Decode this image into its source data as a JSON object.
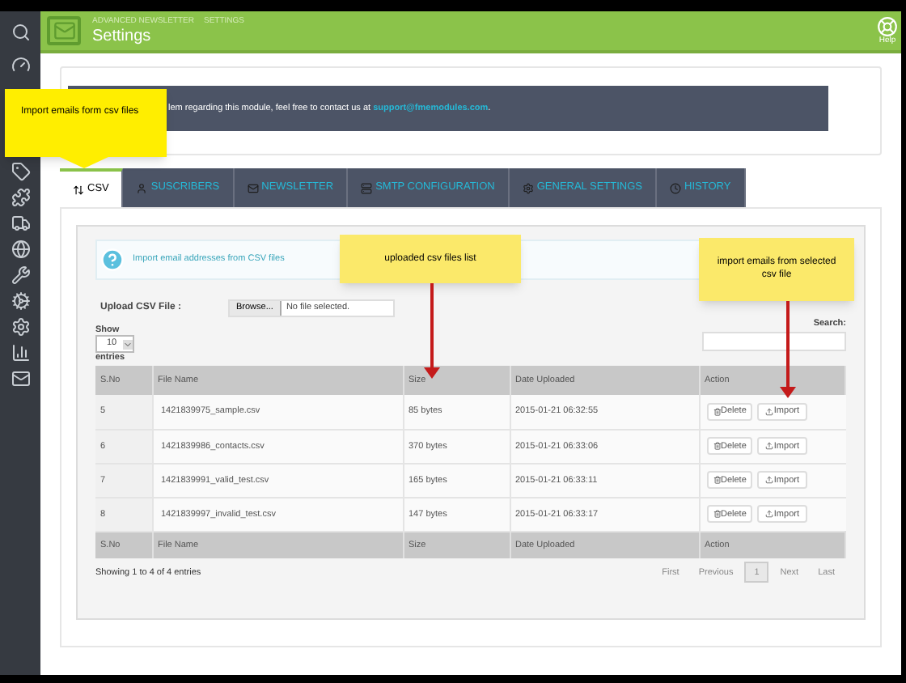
{
  "header": {
    "breadcrumb": [
      "ADVANCED NEWSLETTER",
      "SETTINGS"
    ],
    "title": "Settings",
    "help": "Help"
  },
  "banner": {
    "text": "lem regarding this module, feel free to contact us at",
    "link": "support@fmemodules.com",
    "end": "."
  },
  "tabs": [
    {
      "label": "CSV",
      "selected": true
    },
    {
      "label": "SUSCRIBERS",
      "selected": false
    },
    {
      "label": "NEWSLETTER",
      "selected": false
    },
    {
      "label": "SMTP CONFIGURATION",
      "selected": false
    },
    {
      "label": "GENERAL SETTINGS",
      "selected": false
    },
    {
      "label": "HISTORY",
      "selected": false
    }
  ],
  "info": "Import email addresses from CSV files",
  "upload": {
    "label": "Upload CSV File :",
    "browse": "Browse...",
    "value": "No file selected."
  },
  "length": {
    "show": "Show",
    "value": "10",
    "entries": "entries"
  },
  "search": {
    "label": "Search:"
  },
  "table": {
    "columns": [
      "S.No",
      "File Name",
      "Size",
      "Date Uploaded",
      "Action"
    ],
    "rows": [
      {
        "cells": [
          "5",
          "1421839975_sample.csv",
          "85 bytes",
          "2015-01-21 06:32:55"
        ],
        "actions": [
          "Delete",
          "Import"
        ]
      },
      {
        "cells": [
          "6",
          "1421839986_contacts.csv",
          "370 bytes",
          "2015-01-21 06:33:06"
        ],
        "actions": [
          "Delete",
          "Import"
        ]
      },
      {
        "cells": [
          "7",
          "1421839991_valid_test.csv",
          "165 bytes",
          "2015-01-21 06:33:11"
        ],
        "actions": [
          "Delete",
          "Import"
        ]
      },
      {
        "cells": [
          "8",
          "1421839997_invalid_test.csv",
          "147 bytes",
          "2015-01-21 06:33:17"
        ],
        "actions": [
          "Delete",
          "Import"
        ]
      }
    ],
    "footer_columns": [
      "S.No",
      "File Name",
      "Size",
      "Date Uploaded",
      "Action"
    ]
  },
  "footer": {
    "info": "Showing 1 to 4 of 4 entries",
    "pages": [
      {
        "label": "First",
        "selected": false
      },
      {
        "label": "Previous",
        "selected": false
      },
      {
        "label": "1",
        "selected": true
      },
      {
        "label": "Next",
        "selected": false
      },
      {
        "label": "Last",
        "selected": false
      }
    ]
  },
  "callouts": [
    "Import emails form csv files",
    "uploaded csv files list",
    "import emails from selected csv file"
  ]
}
